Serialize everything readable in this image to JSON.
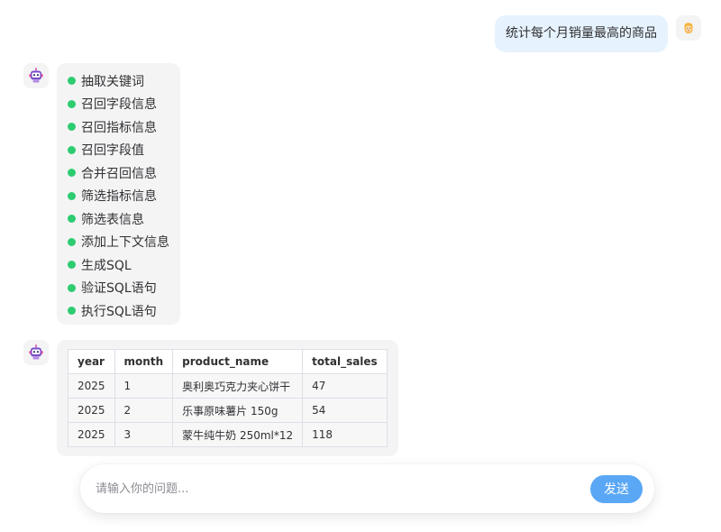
{
  "user_message": {
    "text": "统计每个月销量最高的商品",
    "avatar_icon": "user-avatar-icon"
  },
  "bot_avatar_icon": "robot-avatar-icon",
  "steps": [
    {
      "label": "抽取关键词",
      "status_color": "#2ecc71"
    },
    {
      "label": "召回字段信息",
      "status_color": "#2ecc71"
    },
    {
      "label": "召回指标信息",
      "status_color": "#2ecc71"
    },
    {
      "label": "召回字段值",
      "status_color": "#2ecc71"
    },
    {
      "label": "合并召回信息",
      "status_color": "#2ecc71"
    },
    {
      "label": "筛选指标信息",
      "status_color": "#2ecc71"
    },
    {
      "label": "筛选表信息",
      "status_color": "#2ecc71"
    },
    {
      "label": "添加上下文信息",
      "status_color": "#2ecc71"
    },
    {
      "label": "生成SQL",
      "status_color": "#2ecc71"
    },
    {
      "label": "验证SQL语句",
      "status_color": "#2ecc71"
    },
    {
      "label": "执行SQL语句",
      "status_color": "#2ecc71"
    }
  ],
  "result_table": {
    "columns": [
      "year",
      "month",
      "product_name",
      "total_sales"
    ],
    "rows": [
      [
        "2025",
        "1",
        "奥利奥巧克力夹心饼干",
        "47"
      ],
      [
        "2025",
        "2",
        "乐事原味薯片 150g",
        "54"
      ],
      [
        "2025",
        "3",
        "蒙牛纯牛奶 250ml*12",
        "118"
      ]
    ]
  },
  "input": {
    "value": "",
    "placeholder": "请输入你的问题..."
  },
  "send_button": {
    "label": "发送",
    "color": "#5aa7f5"
  }
}
